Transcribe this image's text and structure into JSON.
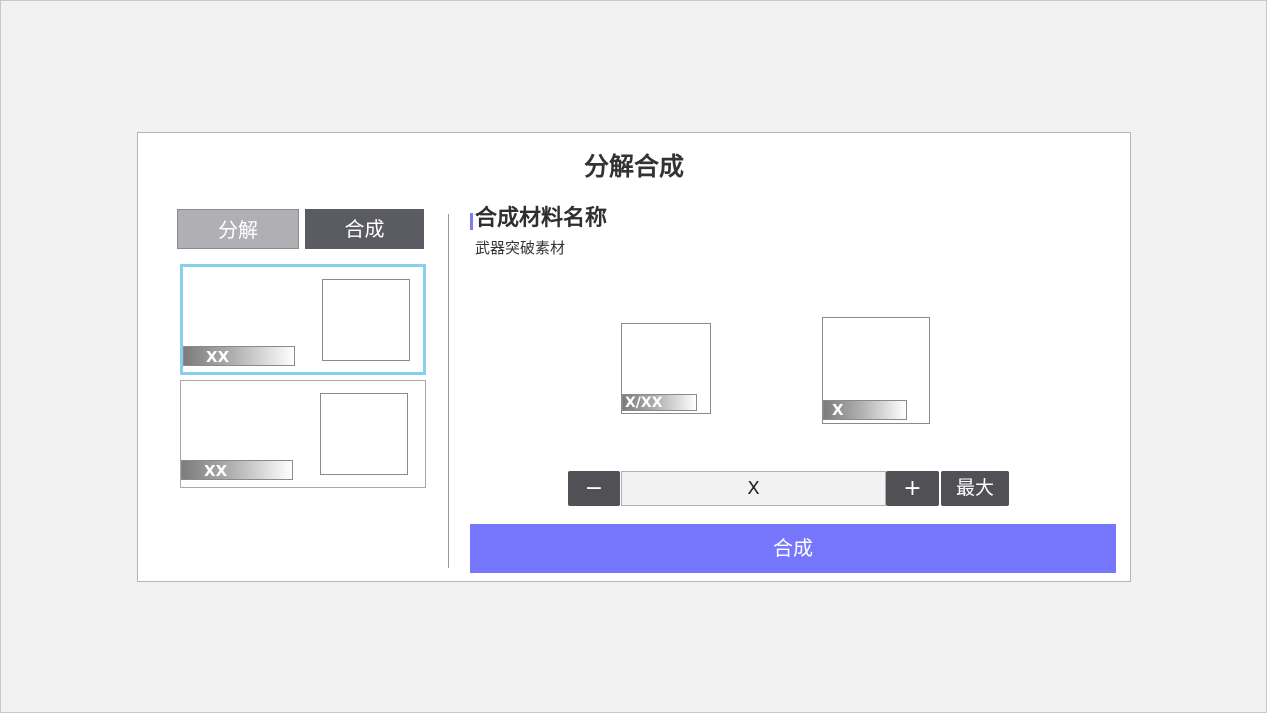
{
  "dialog": {
    "title": "分解合成"
  },
  "tabs": [
    {
      "label": "分解"
    },
    {
      "label": "合成"
    }
  ],
  "material_list": [
    {
      "count": "XX",
      "selected": true
    },
    {
      "count": "XX",
      "selected": false
    }
  ],
  "detail": {
    "name": "合成材料名称",
    "type": "武器突破素材",
    "source_count": "X/XX",
    "result_count": "X"
  },
  "quantity": {
    "minus_label": "−",
    "value": "X",
    "plus_label": "+",
    "max_label": "最大"
  },
  "actions": {
    "compose_label": "合成"
  },
  "colors": {
    "accent": "#7777fd",
    "selected_border": "#86d0ea",
    "tab_active": "#5b5b63",
    "tab_inactive": "#b0b0b4"
  }
}
